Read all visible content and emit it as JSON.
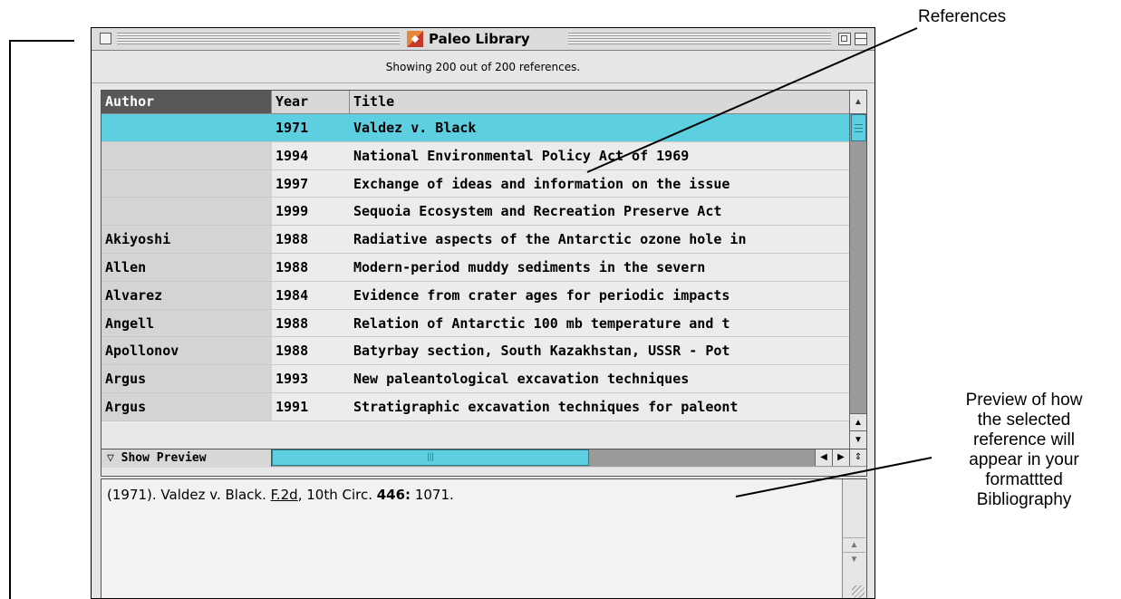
{
  "window": {
    "title": "Paleo Library",
    "status": "Showing 200 out of 200 references."
  },
  "table": {
    "headers": [
      "Author",
      "Year",
      "Title"
    ],
    "rows": [
      {
        "author": "",
        "year": "1971",
        "title": "Valdez v. Black"
      },
      {
        "author": "",
        "year": "1994",
        "title": "National Environmental Policy Act of 1969"
      },
      {
        "author": "",
        "year": "1997",
        "title": "Exchange of ideas and information on the issue"
      },
      {
        "author": "",
        "year": "1999",
        "title": "Sequoia Ecosystem and Recreation Preserve Act"
      },
      {
        "author": "Akiyoshi",
        "year": "1988",
        "title": "Radiative aspects of the Antarctic ozone hole in"
      },
      {
        "author": "Allen",
        "year": "1988",
        "title": "Modern-period muddy sediments in the severn"
      },
      {
        "author": "Alvarez",
        "year": "1984",
        "title": "Evidence from crater ages for periodic impacts"
      },
      {
        "author": "Angell",
        "year": "1988",
        "title": "Relation of Antarctic 100 mb temperature and t"
      },
      {
        "author": "Apollonov",
        "year": "1988",
        "title": "Batyrbay section, South Kazakhstan, USSR - Pot"
      },
      {
        "author": "Argus",
        "year": "1993",
        "title": "New paleantological excavation techniques"
      },
      {
        "author": "Argus",
        "year": "1991",
        "title": "Stratigraphic excavation techniques for paleont"
      }
    ],
    "selected_row": 0
  },
  "preview_toggle": {
    "label": "Show Preview"
  },
  "preview": {
    "prefix": "(1971). Valdez v. Black. ",
    "journal": "F.2d",
    "middle": ", 10th Circ. ",
    "volume": "446:",
    "pages": " 1071."
  },
  "callouts": {
    "references": "References",
    "preview_lines": [
      "Preview of how",
      "the selected",
      "reference will",
      "appear in your",
      "formattted",
      "Bibliography"
    ]
  },
  "colors": {
    "selection": "#5ecfe0",
    "sorted_header": "#585858"
  },
  "icons": [
    "close-box-icon",
    "app-icon",
    "zoom-box-icon",
    "collapse-box-icon",
    "triangle-down-icon",
    "scroll-up-icon",
    "scroll-down-icon",
    "scroll-left-icon",
    "scroll-right-icon",
    "resize-grip-icon"
  ]
}
